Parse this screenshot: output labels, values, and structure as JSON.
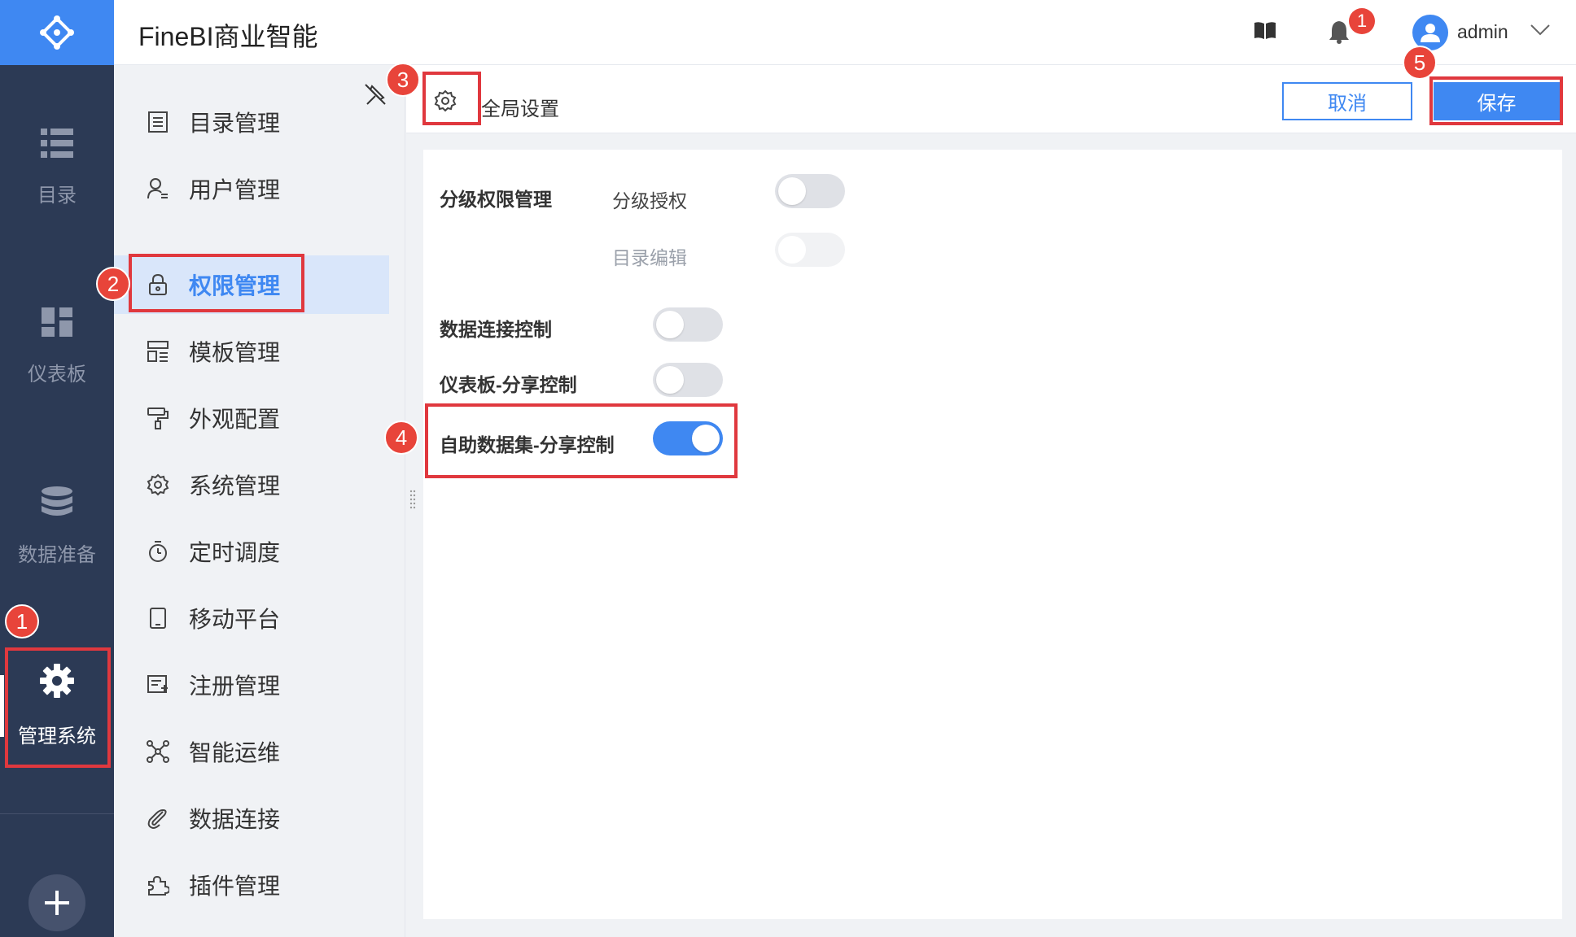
{
  "app": {
    "title": "FineBI商业智能"
  },
  "rail": {
    "items": [
      {
        "label": "目录",
        "icon": "list-icon"
      },
      {
        "label": "仪表板",
        "icon": "dashboard-icon"
      },
      {
        "label": "数据准备",
        "icon": "database-icon"
      },
      {
        "label": "管理系统",
        "icon": "gear-icon",
        "active": true
      }
    ]
  },
  "header": {
    "notification_count": "1",
    "username": "admin"
  },
  "menu": {
    "items": [
      {
        "label": "目录管理",
        "icon": "catalog-icon"
      },
      {
        "label": "用户管理",
        "icon": "user-icon"
      },
      {
        "label": "权限管理",
        "icon": "lock-icon",
        "active": true
      },
      {
        "label": "模板管理",
        "icon": "template-icon"
      },
      {
        "label": "外观配置",
        "icon": "paint-roller-icon"
      },
      {
        "label": "系统管理",
        "icon": "gear-icon"
      },
      {
        "label": "定时调度",
        "icon": "timer-icon"
      },
      {
        "label": "移动平台",
        "icon": "tablet-icon"
      },
      {
        "label": "注册管理",
        "icon": "register-icon"
      },
      {
        "label": "智能运维",
        "icon": "network-icon"
      },
      {
        "label": "数据连接",
        "icon": "link-icon"
      },
      {
        "label": "插件管理",
        "icon": "plugin-icon"
      }
    ]
  },
  "main": {
    "tab_label": "全局设置",
    "cancel_label": "取消",
    "save_label": "保存",
    "settings": {
      "hierarchy_title": "分级权限管理",
      "hierarchy_grant_label": "分级授权",
      "hierarchy_grant_on": false,
      "catalog_edit_label": "目录编辑",
      "catalog_edit_on": false,
      "catalog_edit_disabled": true,
      "data_connection_label": "数据连接控制",
      "data_connection_on": false,
      "dashboard_share_label": "仪表板-分享控制",
      "dashboard_share_on": false,
      "dataset_share_label": "自助数据集-分享控制",
      "dataset_share_on": true
    }
  },
  "annotations": [
    "1",
    "2",
    "3",
    "4",
    "5"
  ],
  "colors": {
    "accent": "#3f88f2",
    "rail": "#2c3a55",
    "highlight": "#e0383e"
  }
}
